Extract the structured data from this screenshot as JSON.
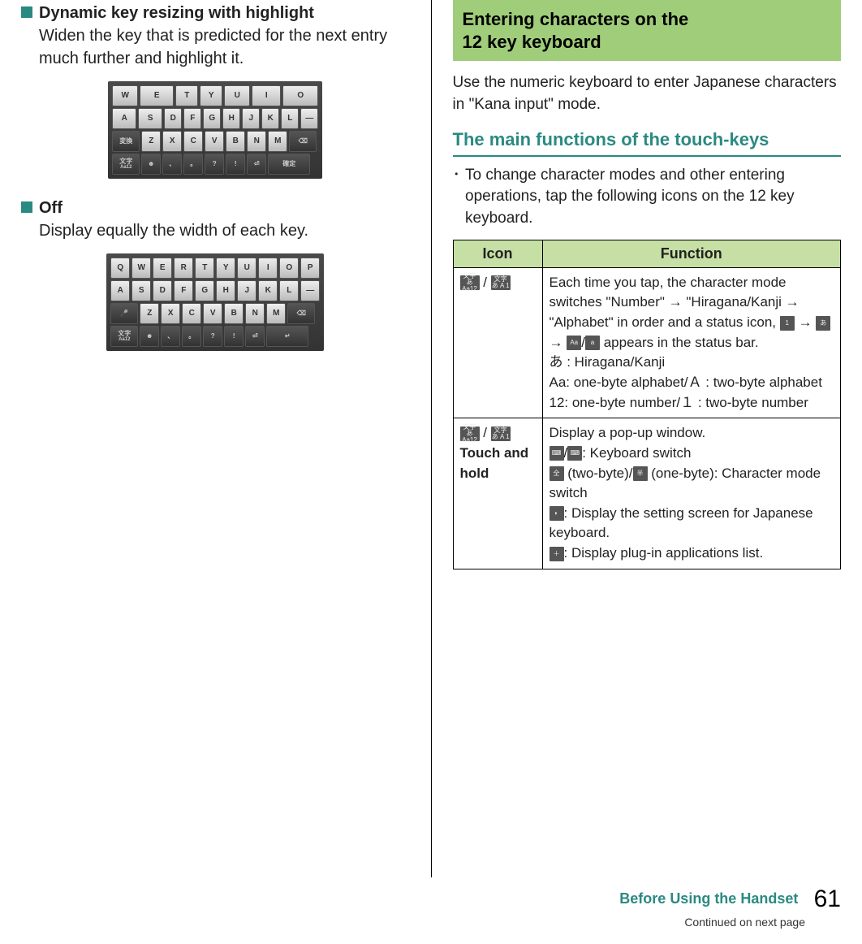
{
  "left": {
    "item1": {
      "title": "Dynamic key resizing with highlight",
      "desc": "Widen the key that is predicted for the next entry much further and highlight it."
    },
    "item2": {
      "title": "Off",
      "desc": "Display equally the width of each key."
    },
    "kb_highlight": {
      "row1": [
        "W",
        "E",
        "T",
        "Y",
        "U",
        "I",
        "O"
      ],
      "row2": [
        "A",
        "S",
        "D",
        "F",
        "G",
        "H",
        "J",
        "K",
        "L",
        "—"
      ],
      "row3_left": "変換",
      "row3": [
        "Z",
        "X",
        "C",
        "V",
        "B",
        "N",
        "M"
      ],
      "row3_back": "⌫",
      "row4_moji": "文字",
      "row4_moji_sub": "Aa12",
      "row4": [
        "☻",
        "、",
        "。",
        "?",
        "!",
        "⏎"
      ],
      "row4_confirm": "確定"
    },
    "kb_equal": {
      "row1": [
        "Q",
        "W",
        "E",
        "R",
        "T",
        "Y",
        "U",
        "I",
        "O",
        "P"
      ],
      "row2": [
        "A",
        "S",
        "D",
        "F",
        "G",
        "H",
        "J",
        "K",
        "L",
        "—"
      ],
      "row3_mic": "🎤",
      "row3": [
        "Z",
        "X",
        "C",
        "V",
        "B",
        "N",
        "M"
      ],
      "row3_back": "⌫",
      "row4_moji": "文字",
      "row4_moji_sub": "Aa12",
      "row4": [
        "☻",
        "、",
        "。",
        "?",
        "!",
        "⏎"
      ],
      "row4_enter": "↵"
    }
  },
  "right": {
    "banner_l1": "Entering characters on the",
    "banner_l2": "12 key keyboard",
    "intro": "Use the numeric keyboard to enter Japanese characters in \"Kana input\" mode.",
    "subheading": "The main functions of the touch-keys",
    "note_bullet": "･",
    "note": "To change character modes and other entering operations, tap the following icons on the 12 key keyboard.",
    "table": {
      "head_icon": "Icon",
      "head_func": "Function",
      "row1": {
        "icon_a": "文字\nあAa12",
        "sep": " / ",
        "icon_b": "文字\nあ A 1",
        "func_p1a": "Each time you tap, the character mode switches \"Number\" → \"Hiragana/Kanji → \"Alphabet\" in order and a status icon, ",
        "seq1": "1",
        "arrow": " → ",
        "seq2": "あ",
        "seq3a": "Aa",
        "seq_slash": "/",
        "seq3b": "a",
        "func_p1b": " appears in the status bar.",
        "func_l2": "あ : Hiragana/Kanji",
        "func_l3": "Aa: one-byte alphabet/Ａ : two-byte alphabet",
        "func_l4": "12: one-byte number/１ : two-byte number"
      },
      "row2": {
        "icon_a": "文字\nあAa12",
        "sep": " / ",
        "icon_b": "文字\nあ A 1",
        "sub": "Touch and hold",
        "func_l1": "Display a pop-up window.",
        "kb_a": "⌨",
        "slash": "/",
        "kb_b": "⌨",
        "func_l2_tail": ": Keyboard switch",
        "full": "全",
        "half": "半",
        "func_l3": " (two-byte)/",
        "func_l3_tail": " (one-byte): Character mode switch",
        "gear": "◐",
        "func_l4": ": Display the setting screen for Japanese keyboard.",
        "plug": "＋",
        "func_l5": ": Display plug-in applications list."
      }
    }
  },
  "footer": {
    "section": "Before Using the Handset",
    "page": "61",
    "cont": "Continued on next page"
  }
}
